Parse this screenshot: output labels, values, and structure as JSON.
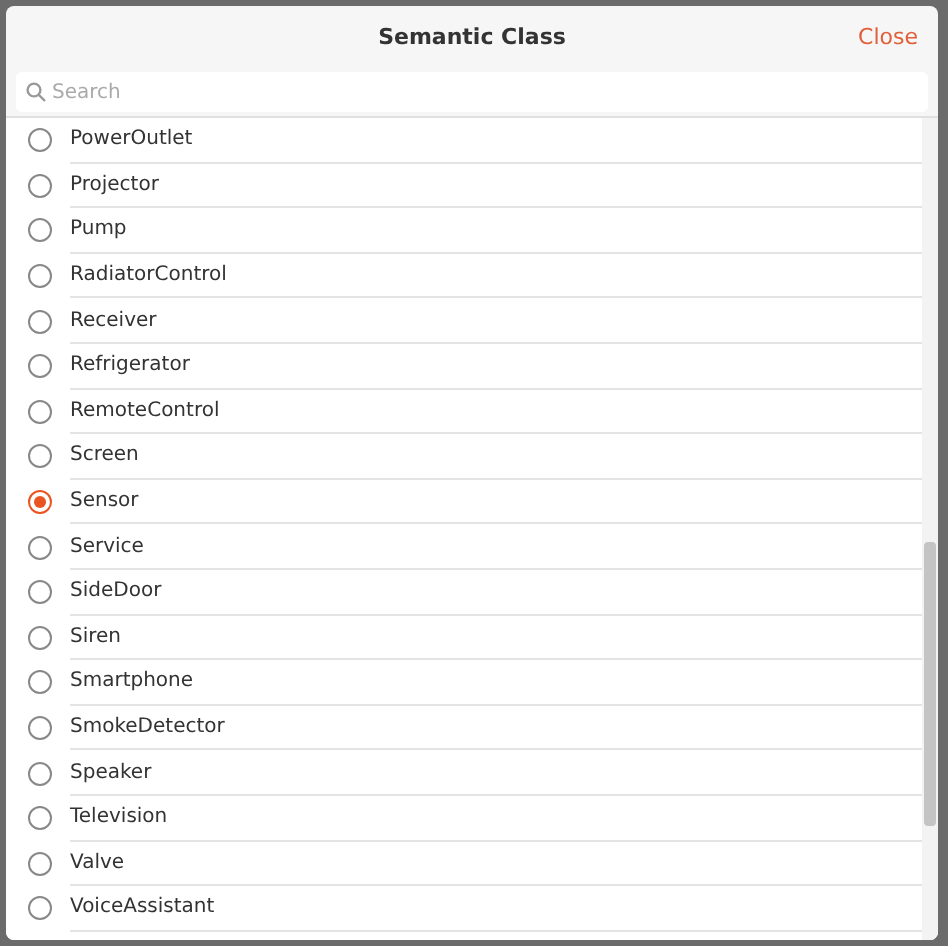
{
  "dialog": {
    "title": "Semantic Class",
    "close": "Close"
  },
  "search": {
    "placeholder": "Search"
  },
  "items": [
    {
      "label": "PowerOutlet",
      "selected": false
    },
    {
      "label": "Projector",
      "selected": false
    },
    {
      "label": "Pump",
      "selected": false
    },
    {
      "label": "RadiatorControl",
      "selected": false
    },
    {
      "label": "Receiver",
      "selected": false
    },
    {
      "label": "Refrigerator",
      "selected": false
    },
    {
      "label": "RemoteControl",
      "selected": false
    },
    {
      "label": "Screen",
      "selected": false
    },
    {
      "label": "Sensor",
      "selected": true
    },
    {
      "label": "Service",
      "selected": false
    },
    {
      "label": "SideDoor",
      "selected": false
    },
    {
      "label": "Siren",
      "selected": false
    },
    {
      "label": "Smartphone",
      "selected": false
    },
    {
      "label": "SmokeDetector",
      "selected": false
    },
    {
      "label": "Speaker",
      "selected": false
    },
    {
      "label": "Television",
      "selected": false
    },
    {
      "label": "Valve",
      "selected": false
    },
    {
      "label": "VoiceAssistant",
      "selected": false
    }
  ]
}
